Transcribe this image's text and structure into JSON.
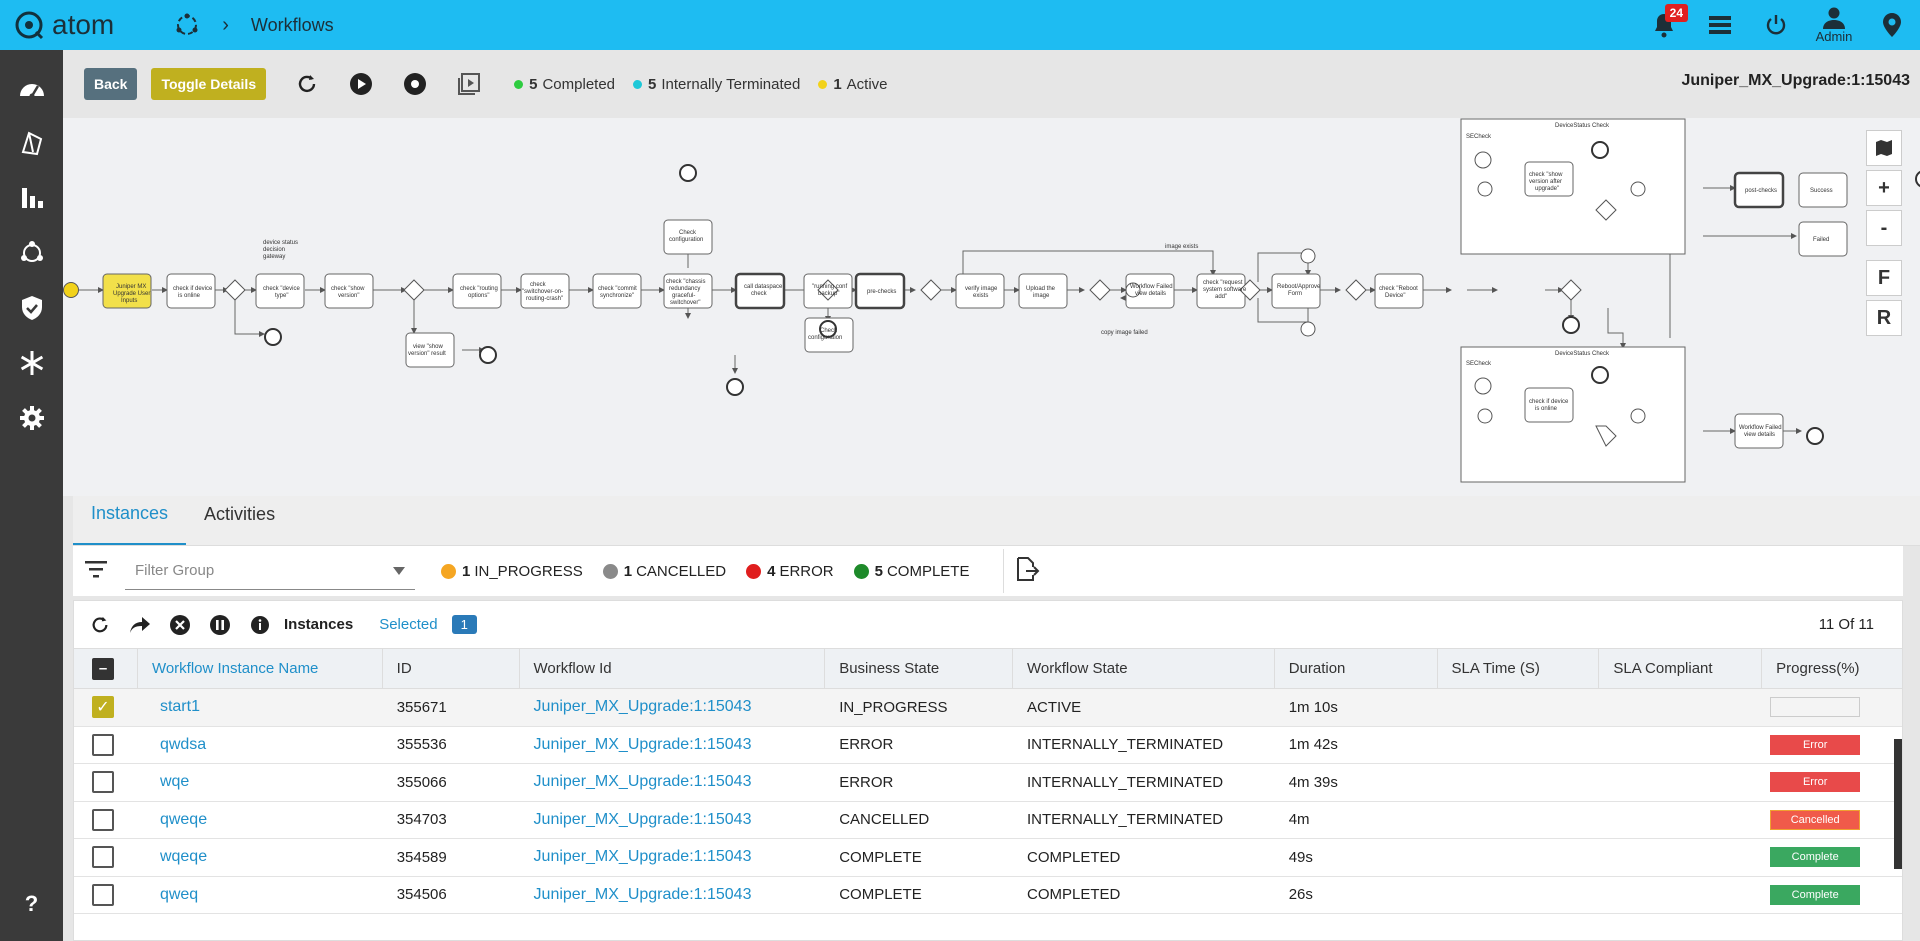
{
  "app": {
    "name": "atom",
    "breadcrumb": "Workflows",
    "notifications": "24",
    "user": "Admin"
  },
  "toolbar": {
    "back": "Back",
    "toggle": "Toggle Details",
    "stats": [
      {
        "count": "5",
        "label": "Completed",
        "color": "#2ecc40"
      },
      {
        "count": "5",
        "label": "Internally Terminated",
        "color": "#1ec8d8"
      },
      {
        "count": "1",
        "label": "Active",
        "color": "#f2d21a"
      }
    ],
    "workflow_title": "Juniper_MX_Upgrade:1:15043"
  },
  "diagram": {
    "tasks": [
      "Juniper MX Upgrade User Inputs",
      "check if device is online",
      "check \"device type\"",
      "check \"show version\"",
      "check \"routing options\"",
      "check \"switchover-on-routing-crash\"",
      "check \"commit synchronize\"",
      "check \"chassis redundancy graceful-switchover\"",
      "call dataspace check",
      "Check configuration",
      "Check configuration",
      "\"running conf backup\"",
      "pre-checks",
      "verify image exists",
      "Upload the image",
      "check \"request system software add\"",
      "Workflow Failed view details",
      "Reboot/Approve Form",
      "check \"Reboot Device\"",
      "post-checks",
      "Success",
      "Failed",
      "view \"show version\" result",
      "Workflow Failed view details"
    ],
    "labels": [
      "device status decision gateway",
      "image exists",
      "copy image failed",
      "DeviceStatus Check",
      "SECheck",
      "check \"show version after upgrade\"",
      "check if device is online"
    ],
    "zoom": [
      "+",
      "-",
      "F",
      "R"
    ]
  },
  "tabs": [
    "Instances",
    "Activities"
  ],
  "filter": {
    "placeholder": "Filter Group",
    "legend": [
      {
        "count": "1",
        "label": "IN_PROGRESS",
        "color": "#f5a623"
      },
      {
        "count": "1",
        "label": "CANCELLED",
        "color": "#8a8a8a"
      },
      {
        "count": "4",
        "label": "ERROR",
        "color": "#e01e1e"
      },
      {
        "count": "5",
        "label": "COMPLETE",
        "color": "#1e8a2a"
      }
    ]
  },
  "table": {
    "toolbar_label": "Instances",
    "selected_label": "Selected",
    "selected_count": "1",
    "count_label": "11 Of 11",
    "columns": [
      "Workflow Instance Name",
      "ID",
      "Workflow Id",
      "Business State",
      "Workflow State",
      "Duration",
      "SLA Time (S)",
      "SLA Compliant",
      "Progress(%)"
    ],
    "rows": [
      {
        "name": "start1",
        "id": "355671",
        "wfid": "Juniper_MX_Upgrade:1:15043",
        "bstate": "IN_PROGRESS",
        "wstate": "ACTIVE",
        "duration": "1m 10s",
        "sla": "",
        "compliant": "",
        "progress": "",
        "checked": true
      },
      {
        "name": "qwdsa",
        "id": "355536",
        "wfid": "Juniper_MX_Upgrade:1:15043",
        "bstate": "ERROR",
        "wstate": "INTERNALLY_TERMINATED",
        "duration": "1m 42s",
        "sla": "",
        "compliant": "",
        "progress": "Error"
      },
      {
        "name": "wqe",
        "id": "355066",
        "wfid": "Juniper_MX_Upgrade:1:15043",
        "bstate": "ERROR",
        "wstate": "INTERNALLY_TERMINATED",
        "duration": "4m 39s",
        "sla": "",
        "compliant": "",
        "progress": "Error"
      },
      {
        "name": "qweqe",
        "id": "354703",
        "wfid": "Juniper_MX_Upgrade:1:15043",
        "bstate": "CANCELLED",
        "wstate": "INTERNALLY_TERMINATED",
        "duration": "4m",
        "sla": "",
        "compliant": "",
        "progress": "Cancelled"
      },
      {
        "name": "wqeqe",
        "id": "354589",
        "wfid": "Juniper_MX_Upgrade:1:15043",
        "bstate": "COMPLETE",
        "wstate": "COMPLETED",
        "duration": "49s",
        "sla": "",
        "compliant": "",
        "progress": "Complete"
      },
      {
        "name": "qweq",
        "id": "354506",
        "wfid": "Juniper_MX_Upgrade:1:15043",
        "bstate": "COMPLETE",
        "wstate": "COMPLETED",
        "duration": "26s",
        "sla": "",
        "compliant": "",
        "progress": "Complete"
      }
    ]
  }
}
